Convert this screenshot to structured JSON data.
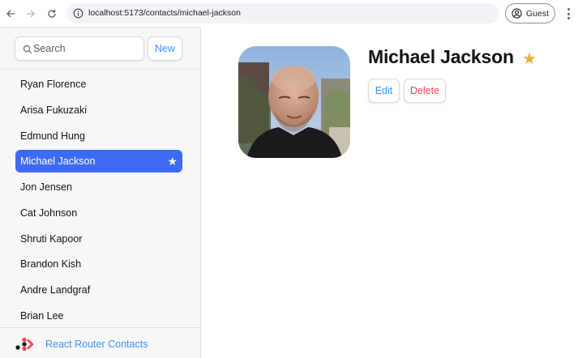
{
  "browser": {
    "url": "localhost:5173/contacts/michael-jackson",
    "profile_label": "Guest"
  },
  "sidebar": {
    "search_placeholder": "Search",
    "new_label": "New",
    "contacts": [
      {
        "name": "Ryan Florence",
        "active": false,
        "favorite": false
      },
      {
        "name": "Arisa Fukuzaki",
        "active": false,
        "favorite": false
      },
      {
        "name": "Edmund Hung",
        "active": false,
        "favorite": false
      },
      {
        "name": "Michael Jackson",
        "active": true,
        "favorite": true
      },
      {
        "name": "Jon Jensen",
        "active": false,
        "favorite": false
      },
      {
        "name": "Cat Johnson",
        "active": false,
        "favorite": false
      },
      {
        "name": "Shruti Kapoor",
        "active": false,
        "favorite": false
      },
      {
        "name": "Brandon Kish",
        "active": false,
        "favorite": false
      },
      {
        "name": "Andre Landgraf",
        "active": false,
        "favorite": false
      },
      {
        "name": "Brian Lee",
        "active": false,
        "favorite": false
      }
    ],
    "favorite_star": "★",
    "footer_label": "React Router Contacts"
  },
  "detail": {
    "name": "Michael Jackson",
    "favorite_star": "★",
    "edit_label": "Edit",
    "delete_label": "Delete"
  },
  "colors": {
    "accent": "#3992ff",
    "active_item": "#3d6af5",
    "delete": "#f44250",
    "favorite": "#e3b341"
  }
}
